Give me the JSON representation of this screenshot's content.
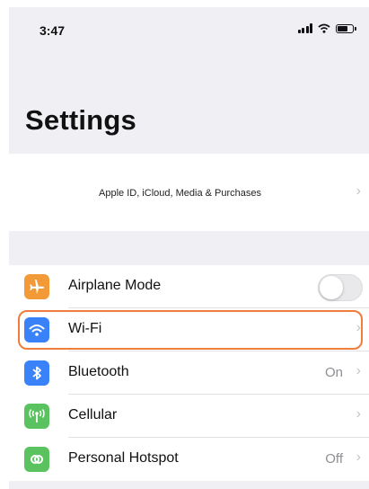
{
  "status_bar": {
    "time": "3:47",
    "icons": [
      "cellular-signal-icon",
      "wifi-icon",
      "battery-icon"
    ],
    "battery_level": 0.75
  },
  "page": {
    "title": "Settings"
  },
  "apple_id": {
    "subtitle": "Apple ID, iCloud, Media & Purchases"
  },
  "settings": [
    {
      "label": "Airplane Mode",
      "icon": "airplane-icon",
      "icon_color": "#f19a37",
      "control": "toggle",
      "toggle_on": false
    },
    {
      "label": "Wi-Fi",
      "icon": "wifi-icon",
      "icon_color": "#3a82f7",
      "control": "chevron",
      "highlighted": true
    },
    {
      "label": "Bluetooth",
      "icon": "bluetooth-icon",
      "icon_color": "#3a82f7",
      "value": "On",
      "control": "chevron"
    },
    {
      "label": "Cellular",
      "icon": "cellular-antenna-icon",
      "icon_color": "#5ac35f",
      "control": "chevron"
    },
    {
      "label": "Personal Hotspot",
      "icon": "hotspot-link-icon",
      "icon_color": "#5ac35f",
      "value": "Off",
      "control": "chevron"
    }
  ],
  "colors": {
    "background": "#efeff4",
    "highlight": "#f07d3c",
    "secondary_text": "#8e8e93"
  }
}
